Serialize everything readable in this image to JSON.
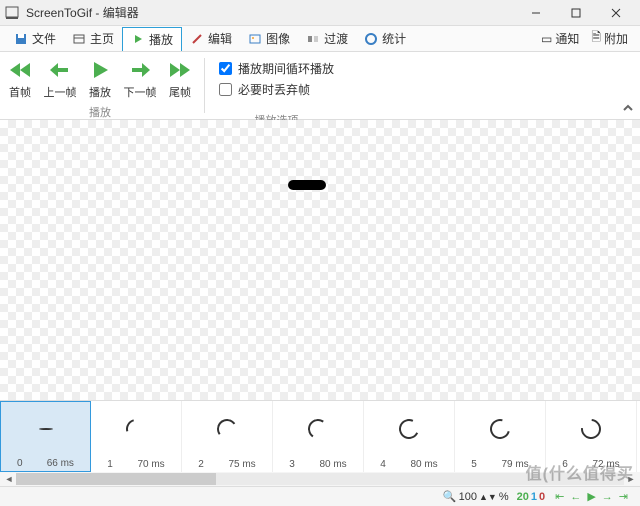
{
  "title": "ScreenToGif - 编辑器",
  "menu": {
    "file": "文件",
    "home": "主页",
    "playback": "播放",
    "edit": "编辑",
    "image": "图像",
    "transition": "过渡",
    "stats": "统计"
  },
  "topright": {
    "notify": "通知",
    "attach": "附加"
  },
  "ribbon": {
    "first": "首帧",
    "prev": "上一帧",
    "play": "播放",
    "next": "下一帧",
    "last": "尾帧",
    "group_label": "播放",
    "opt_loop": "播放期间循环播放",
    "opt_drop": "必要时丢弃帧",
    "options_label": "播放选项"
  },
  "frames": [
    {
      "idx": "0",
      "ms": "66 ms"
    },
    {
      "idx": "1",
      "ms": "70 ms"
    },
    {
      "idx": "2",
      "ms": "75 ms"
    },
    {
      "idx": "3",
      "ms": "80 ms"
    },
    {
      "idx": "4",
      "ms": "80 ms"
    },
    {
      "idx": "5",
      "ms": "79 ms"
    },
    {
      "idx": "6",
      "ms": "72 ms"
    }
  ],
  "status": {
    "zoom": "100",
    "pct": "%",
    "total": "20",
    "sel": "1",
    "cur": "0"
  },
  "watermark": "值(什么值得买",
  "colors": {
    "accent": "#2d9fd8",
    "arrow": "#4CAF50"
  }
}
